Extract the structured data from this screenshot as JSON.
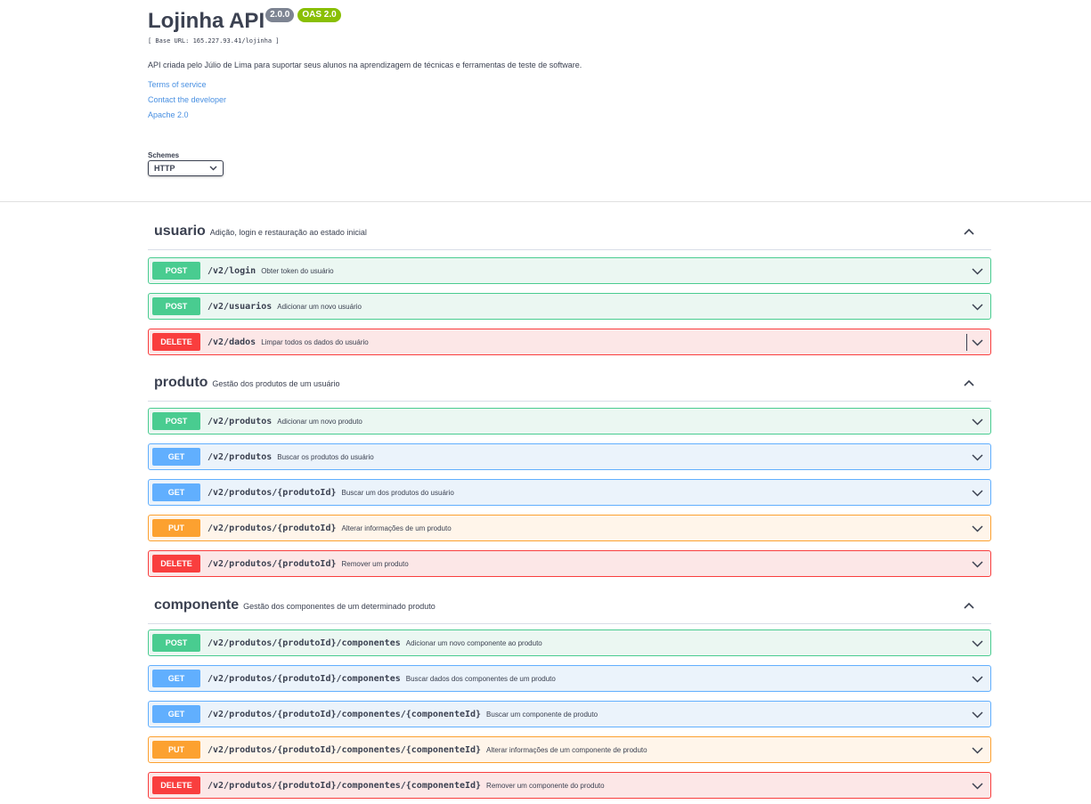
{
  "info": {
    "title": "Lojinha API",
    "version": "2.0.0",
    "oas": "OAS 2.0",
    "base_url": "[ Base URL: 165.227.93.41/lojinha ]",
    "description": "API criada pelo Júlio de Lima para suportar seus alunos na aprendizagem de técnicas e ferramentas de teste de software.",
    "links": {
      "terms": "Terms of service",
      "contact": "Contact the developer",
      "license": "Apache 2.0"
    }
  },
  "schemes": {
    "label": "Schemes",
    "selected": "HTTP"
  },
  "colors": {
    "post": "#49cc90",
    "get": "#61affe",
    "put": "#fca130",
    "delete": "#f93e3e",
    "link": "#4990e2"
  },
  "tags": [
    {
      "name": "usuario",
      "description": "Adição, login e restauração ao estado inicial",
      "operations": [
        {
          "method": "POST",
          "path": "/v2/login",
          "summary": "Obter token do usuário"
        },
        {
          "method": "POST",
          "path": "/v2/usuarios",
          "summary": "Adicionar um novo usuário"
        },
        {
          "method": "DELETE",
          "path": "/v2/dados",
          "summary": "Limpar todos os dados do usuário"
        }
      ]
    },
    {
      "name": "produto",
      "description": "Gestão dos produtos de um usuário",
      "operations": [
        {
          "method": "POST",
          "path": "/v2/produtos",
          "summary": "Adicionar um novo produto"
        },
        {
          "method": "GET",
          "path": "/v2/produtos",
          "summary": "Buscar os produtos do usuário"
        },
        {
          "method": "GET",
          "path": "/v2/produtos/{produtoId}",
          "summary": "Buscar um dos produtos do usuário"
        },
        {
          "method": "PUT",
          "path": "/v2/produtos/{produtoId}",
          "summary": "Alterar informações de um produto"
        },
        {
          "method": "DELETE",
          "path": "/v2/produtos/{produtoId}",
          "summary": "Remover um produto"
        }
      ]
    },
    {
      "name": "componente",
      "description": "Gestão dos componentes de um determinado produto",
      "operations": [
        {
          "method": "POST",
          "path": "/v2/produtos/{produtoId}/componentes",
          "summary": "Adicionar um novo componente ao produto"
        },
        {
          "method": "GET",
          "path": "/v2/produtos/{produtoId}/componentes",
          "summary": "Buscar dados dos componentes de um produto"
        },
        {
          "method": "GET",
          "path": "/v2/produtos/{produtoId}/componentes/{componenteId}",
          "summary": "Buscar um componente de produto"
        },
        {
          "method": "PUT",
          "path": "/v2/produtos/{produtoId}/componentes/{componenteId}",
          "summary": "Alterar informações de um componente de produto"
        },
        {
          "method": "DELETE",
          "path": "/v2/produtos/{produtoId}/componentes/{componenteId}",
          "summary": "Remover um componente do produto"
        }
      ]
    }
  ]
}
